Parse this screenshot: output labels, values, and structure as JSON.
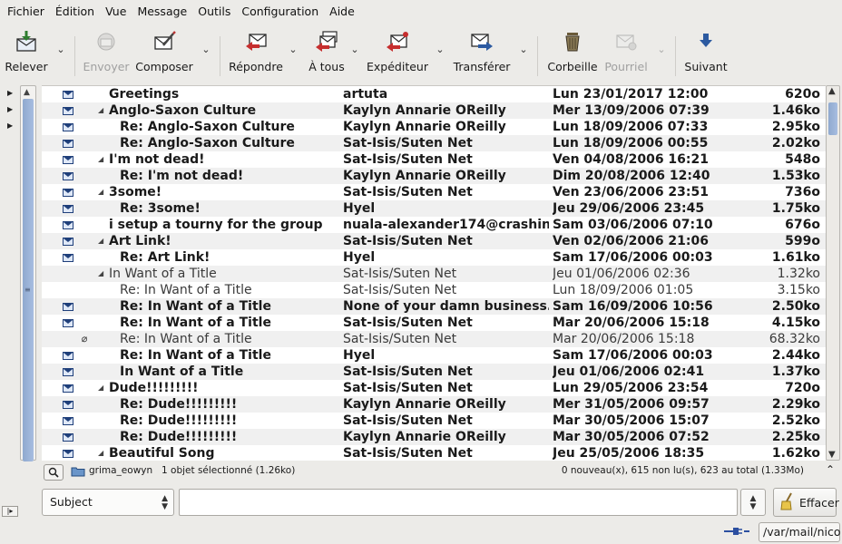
{
  "menu": [
    "Fichier",
    "Édition",
    "Vue",
    "Message",
    "Outils",
    "Configuration",
    "Aide"
  ],
  "toolbar": {
    "relever": "Relever",
    "envoyer": "Envoyer",
    "composer": "Composer",
    "repondre": "Répondre",
    "a_tous": "À tous",
    "expediteur": "Expéditeur",
    "transferer": "Transférer",
    "corbeille": "Corbeille",
    "pourriel": "Pourriel",
    "suivant": "Suivant"
  },
  "messages": [
    {
      "subject": "Greetings",
      "from": "artuta",
      "date": "Lun 23/01/2017 12:00",
      "size": "620o"
    },
    {
      "subject": "Anglo-Saxon Culture",
      "from": "Kaylyn Annarie OReilly",
      "date": "Mer 13/09/2006 07:39",
      "size": "1.46ko"
    },
    {
      "subject": "Re: Anglo-Saxon Culture",
      "from": "Kaylyn Annarie OReilly",
      "date": "Lun 18/09/2006 07:33",
      "size": "2.95ko"
    },
    {
      "subject": "Re: Anglo-Saxon Culture",
      "from": "Sat-Isis/Suten Net",
      "date": "Lun 18/09/2006 00:55",
      "size": "2.02ko"
    },
    {
      "subject": "I'm not dead!",
      "from": "Sat-Isis/Suten Net",
      "date": "Ven 04/08/2006 16:21",
      "size": "548o"
    },
    {
      "subject": "Re: I'm not dead!",
      "from": "Kaylyn Annarie OReilly",
      "date": "Dim 20/08/2006 12:40",
      "size": "1.53ko"
    },
    {
      "subject": "3some!",
      "from": "Sat-Isis/Suten Net",
      "date": "Ven 23/06/2006 23:51",
      "size": "736o"
    },
    {
      "subject": "Re: 3some!",
      "from": "Hyel",
      "date": "Jeu 29/06/2006 23:45",
      "size": "1.75ko"
    },
    {
      "subject": "i setup a tourny for the group",
      "from": "nuala-alexander174@crashint",
      "date": "Sam 03/06/2006 07:10",
      "size": "676o"
    },
    {
      "subject": "Art Link!",
      "from": "Sat-Isis/Suten Net",
      "date": "Ven 02/06/2006 21:06",
      "size": "599o"
    },
    {
      "subject": "Re: Art Link!",
      "from": "Hyel",
      "date": "Sam 17/06/2006 00:03",
      "size": "1.61ko"
    },
    {
      "subject": "In Want of a Title",
      "from": "Sat-Isis/Suten Net",
      "date": "Jeu 01/06/2006 02:36",
      "size": "1.32ko"
    },
    {
      "subject": "Re: In Want of a Title",
      "from": "Sat-Isis/Suten Net",
      "date": "Lun 18/09/2006 01:05",
      "size": "3.15ko"
    },
    {
      "subject": "Re: In Want of a Title",
      "from": "None of your damn business.",
      "date": "Sam 16/09/2006 10:56",
      "size": "2.50ko"
    },
    {
      "subject": "Re: In Want of a Title",
      "from": "Sat-Isis/Suten Net",
      "date": "Mar 20/06/2006 15:18",
      "size": "4.15ko"
    },
    {
      "subject": "Re: In Want of a Title",
      "from": "Sat-Isis/Suten Net",
      "date": "Mar 20/06/2006 15:18",
      "size": "68.32ko"
    },
    {
      "subject": "Re: In Want of a Title",
      "from": "Hyel",
      "date": "Sam 17/06/2006 00:03",
      "size": "2.44ko"
    },
    {
      "subject": "In Want of a Title",
      "from": "Sat-Isis/Suten Net",
      "date": "Jeu 01/06/2006 02:41",
      "size": "1.37ko"
    },
    {
      "subject": "Dude!!!!!!!!!",
      "from": "Sat-Isis/Suten Net",
      "date": "Lun 29/05/2006 23:54",
      "size": "720o"
    },
    {
      "subject": "Re: Dude!!!!!!!!!",
      "from": "Kaylyn Annarie OReilly",
      "date": "Mer 31/05/2006 09:57",
      "size": "2.29ko"
    },
    {
      "subject": "Re: Dude!!!!!!!!!",
      "from": "Sat-Isis/Suten Net",
      "date": "Mar 30/05/2006 15:07",
      "size": "2.52ko"
    },
    {
      "subject": "Re: Dude!!!!!!!!!",
      "from": "Kaylyn Annarie OReilly",
      "date": "Mar 30/05/2006 07:52",
      "size": "2.25ko"
    },
    {
      "subject": "Beautiful Song",
      "from": "Sat-Isis/Suten Net",
      "date": "Jeu 25/05/2006 18:35",
      "size": "1.62ko"
    }
  ],
  "status": {
    "folder": "grima_eowyn",
    "selection": "1 objet sélectionné (1.26ko)",
    "counts": "0 nouveau(x), 615 non lu(s), 623 au total (1.33Mo)"
  },
  "search": {
    "field": "Subject",
    "query": "",
    "clear_label": "Effacer"
  },
  "mailbox_path": "/var/mail/nico"
}
